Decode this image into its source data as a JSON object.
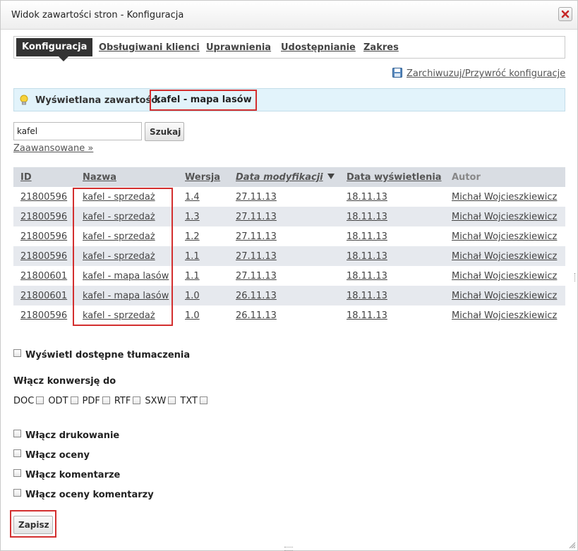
{
  "window": {
    "title": "Widok zawartości stron - Konfiguracja"
  },
  "tabs": [
    {
      "label": "Konfiguracja",
      "active": true
    },
    {
      "label": "Obsługiwani klienci",
      "active": false
    },
    {
      "label": "Uprawnienia",
      "active": false
    },
    {
      "label": "Udostępnianie",
      "active": false
    },
    {
      "label": "Zakres",
      "active": false
    }
  ],
  "archive_link": "Zarchiwuzuj/Przywróć konfiguracje",
  "info": {
    "label": "Wyświetlana zawartość:",
    "value": "kafel - mapa lasów"
  },
  "search": {
    "value": "kafel",
    "button": "Szukaj",
    "advanced": "Zaawansowane »"
  },
  "table": {
    "headers": [
      "ID",
      "Nazwa",
      "Wersja",
      "Data modyfikacji",
      "Data wyświetlenia",
      "Autor"
    ],
    "rows": [
      [
        "21800596",
        "kafel - sprzedaż",
        "1.4",
        "27.11.13",
        "18.11.13",
        "Michał Wojcieszkiewicz"
      ],
      [
        "21800596",
        "kafel - sprzedaż",
        "1.3",
        "27.11.13",
        "18.11.13",
        "Michał Wojcieszkiewicz"
      ],
      [
        "21800596",
        "kafel - sprzedaż",
        "1.2",
        "27.11.13",
        "18.11.13",
        "Michał Wojcieszkiewicz"
      ],
      [
        "21800596",
        "kafel - sprzedaż",
        "1.1",
        "27.11.13",
        "18.11.13",
        "Michał Wojcieszkiewicz"
      ],
      [
        "21800601",
        "kafel - mapa lasów",
        "1.1",
        "27.11.13",
        "18.11.13",
        "Michał Wojcieszkiewicz"
      ],
      [
        "21800601",
        "kafel - mapa lasów",
        "1.0",
        "26.11.13",
        "18.11.13",
        "Michał Wojcieszkiewicz"
      ],
      [
        "21800596",
        "kafel - sprzedaż",
        "1.0",
        "26.11.13",
        "18.11.13",
        "Michał Wojcieszkiewicz"
      ]
    ]
  },
  "translations_label": "Wyświetl dostępne tłumaczenia",
  "conversion": {
    "title": "Włącz konwersję do",
    "formats": [
      "DOC",
      "ODT",
      "PDF",
      "RTF",
      "SXW",
      "TXT"
    ]
  },
  "options": [
    "Włącz drukowanie",
    "Włącz oceny",
    "Włącz komentarze",
    "Włącz oceny komentarzy"
  ],
  "save_button": "Zapisz",
  "colors": {
    "highlight": "#d32f2f",
    "info_bg": "#e2f3fb",
    "header_bg": "#d9dde3",
    "row_alt": "#e6e9ee",
    "active_tab": "#333333"
  }
}
